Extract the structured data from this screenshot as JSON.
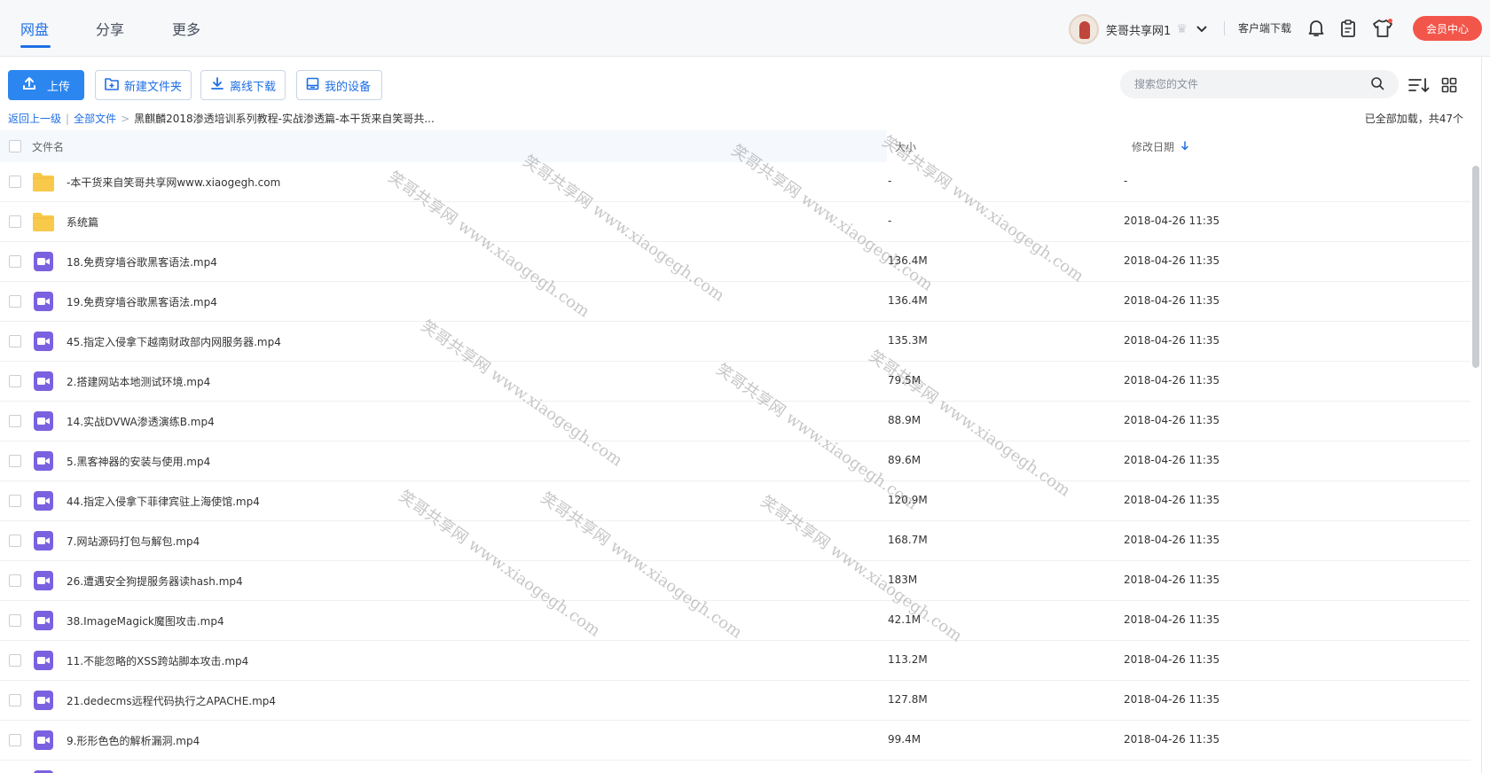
{
  "nav": {
    "tabs": [
      {
        "label": "网盘",
        "active": true
      },
      {
        "label": "分享",
        "active": false
      },
      {
        "label": "更多",
        "active": false
      }
    ],
    "username": "笑哥共享网1",
    "client_download": "客户端下载",
    "vip_center": "会员中心"
  },
  "toolbar": {
    "upload": "上传",
    "new_folder": "新建文件夹",
    "offline_download": "离线下载",
    "my_devices": "我的设备",
    "search_placeholder": "搜索您的文件"
  },
  "breadcrumb": {
    "back": "返回上一级",
    "all_files": "全部文件",
    "current": "黑麒麟2018渗透培训系列教程-实战渗透篇-本干货来自笑哥共..."
  },
  "loaded_text": "已全部加载，共47个",
  "table": {
    "headers": {
      "name": "文件名",
      "size": "大小",
      "date": "修改日期"
    },
    "rows": [
      {
        "type": "folder",
        "name": "-本干货来自笑哥共享网www.xiaogegh.com",
        "size": "-",
        "date": "-"
      },
      {
        "type": "folder",
        "name": "系统篇",
        "size": "-",
        "date": "2018-04-26 11:35"
      },
      {
        "type": "video",
        "name": "18.免费穿墙谷歌黑客语法.mp4",
        "size": "136.4M",
        "date": "2018-04-26 11:35"
      },
      {
        "type": "video",
        "name": "19.免费穿墙谷歌黑客语法.mp4",
        "size": "136.4M",
        "date": "2018-04-26 11:35"
      },
      {
        "type": "video",
        "name": "45.指定入侵拿下越南财政部内网服务器.mp4",
        "size": "135.3M",
        "date": "2018-04-26 11:35"
      },
      {
        "type": "video",
        "name": "2.搭建网站本地测试环境.mp4",
        "size": "79.5M",
        "date": "2018-04-26 11:35"
      },
      {
        "type": "video",
        "name": "14.实战DVWA渗透演练B.mp4",
        "size": "88.9M",
        "date": "2018-04-26 11:35"
      },
      {
        "type": "video",
        "name": "5.黑客神器的安装与使用.mp4",
        "size": "89.6M",
        "date": "2018-04-26 11:35"
      },
      {
        "type": "video",
        "name": "44.指定入侵拿下菲律宾驻上海使馆.mp4",
        "size": "120.9M",
        "date": "2018-04-26 11:35"
      },
      {
        "type": "video",
        "name": "7.网站源码打包与解包.mp4",
        "size": "168.7M",
        "date": "2018-04-26 11:35"
      },
      {
        "type": "video",
        "name": "26.遭遇安全狗提服务器读hash.mp4",
        "size": "183M",
        "date": "2018-04-26 11:35"
      },
      {
        "type": "video",
        "name": "38.ImageMagick魔图攻击.mp4",
        "size": "42.1M",
        "date": "2018-04-26 11:35"
      },
      {
        "type": "video",
        "name": "11.不能忽略的XSS跨站脚本攻击.mp4",
        "size": "113.2M",
        "date": "2018-04-26 11:35"
      },
      {
        "type": "video",
        "name": "21.dedecms远程代码执行之APACHE.mp4",
        "size": "127.8M",
        "date": "2018-04-26 11:35"
      },
      {
        "type": "video",
        "name": "9.形形色色的解析漏洞.mp4",
        "size": "99.4M",
        "date": "2018-04-26 11:35"
      },
      {
        "type": "video",
        "name": "",
        "size": "",
        "date": ""
      }
    ]
  },
  "watermark_text": "笑哥共享网 www.xiaogegh.com",
  "colors": {
    "accent": "#1f6fe5",
    "primary_button": "#2b86f0",
    "vip": "#f2564b",
    "folder": "#f8c94a",
    "video": "#7b61e0"
  }
}
